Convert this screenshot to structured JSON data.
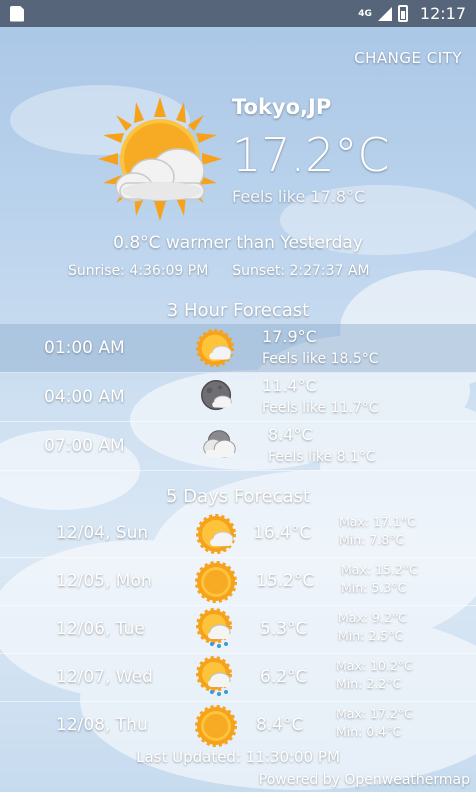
{
  "status_bar": {
    "network": "4G",
    "time": "12:17"
  },
  "change_city_label": "CHANGE CITY",
  "current": {
    "city": "Tokyo,JP",
    "temp": "17.2°C",
    "feels_like": "Feels like 17.8°C",
    "icon": "sun-cloud-icon",
    "comparison": "0.8°C warmer than Yesterday",
    "sunrise": "Sunrise: 4:36:09 PM",
    "sunset": "Sunset: 2:27:37 AM"
  },
  "hourly": {
    "title": "3 Hour Forecast",
    "items": [
      {
        "time": "01:00 AM",
        "temp": "17.9°C",
        "feels": "Feels like 18.5°C",
        "icon": "sun-cloud-icon"
      },
      {
        "time": "04:00 AM",
        "temp": "11.4°C",
        "feels": "Feels like 11.7°C",
        "icon": "moon-cloud-icon"
      },
      {
        "time": "07:00 AM",
        "temp": "8.4°C",
        "feels": "Feels like 8.1°C",
        "icon": "cloudy-icon"
      }
    ]
  },
  "daily": {
    "title": "5 Days Forecast",
    "items": [
      {
        "date": "12/04, Sun",
        "temp": "16.4°C",
        "max": "Max: 17.1°C",
        "min": "Min: 7.8°C",
        "icon": "sun-cloud-icon"
      },
      {
        "date": "12/05, Mon",
        "temp": "15.2°C",
        "max": "Max: 15.2°C",
        "min": "Min: 5.3°C",
        "icon": "sun-icon"
      },
      {
        "date": "12/06, Tue",
        "temp": "5.3°C",
        "max": "Max: 9.2°C",
        "min": "Min: 2.5°C",
        "icon": "sun-rain-icon"
      },
      {
        "date": "12/07, Wed",
        "temp": "6.2°C",
        "max": "Max: 10.2°C",
        "min": "Min: 2.2°C",
        "icon": "sun-rain-icon"
      },
      {
        "date": "12/08, Thu",
        "temp": "8.4°C",
        "max": "Max: 17.2°C",
        "min": "Min: 0.4°C",
        "icon": "sun-icon"
      }
    ]
  },
  "last_updated": "Last Updated: 11:30:00 PM",
  "powered_by": "Powered by Openweathermap",
  "colors": {
    "status_bar": "#56657a",
    "sun": "#f6a21a",
    "sun_light": "#fcc33b",
    "cloud": "#f4f4f4"
  }
}
